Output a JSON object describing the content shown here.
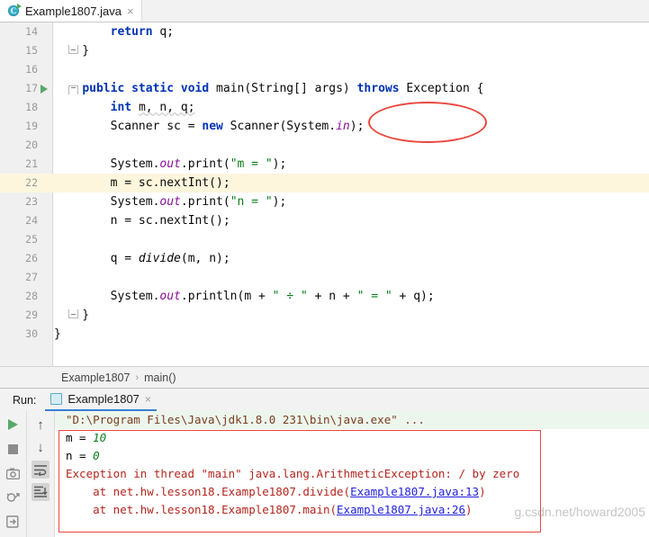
{
  "tab": {
    "label": "Example1807.java",
    "icon": "java-class-icon",
    "close": "×"
  },
  "editor": {
    "current_line": 22,
    "lines": [
      {
        "num": "14",
        "indent": 0,
        "text": "return q;",
        "marker": "",
        "fold": ""
      },
      {
        "num": "15",
        "indent": 0,
        "text": "}",
        "marker": "",
        "fold": "end"
      },
      {
        "num": "16",
        "indent": 0,
        "text": "",
        "marker": "",
        "fold": ""
      },
      {
        "num": "17",
        "indent": 0,
        "text": "public static void main(String[] args) throws Exception {",
        "marker": "run",
        "fold": "start"
      },
      {
        "num": "18",
        "indent": 0,
        "text": "int m, n, q;",
        "marker": "",
        "fold": ""
      },
      {
        "num": "19",
        "indent": 0,
        "text": "Scanner sc = new Scanner(System.in);",
        "marker": "",
        "fold": ""
      },
      {
        "num": "20",
        "indent": 0,
        "text": "",
        "marker": "",
        "fold": ""
      },
      {
        "num": "21",
        "indent": 0,
        "text": "System.out.print(\"m = \");",
        "marker": "",
        "fold": ""
      },
      {
        "num": "22",
        "indent": 0,
        "text": "m = sc.nextInt();",
        "marker": "",
        "fold": ""
      },
      {
        "num": "23",
        "indent": 0,
        "text": "System.out.print(\"n = \");",
        "marker": "",
        "fold": ""
      },
      {
        "num": "24",
        "indent": 0,
        "text": "n = sc.nextInt();",
        "marker": "",
        "fold": ""
      },
      {
        "num": "25",
        "indent": 0,
        "text": "",
        "marker": "",
        "fold": ""
      },
      {
        "num": "26",
        "indent": 0,
        "text": "q = divide(m, n);",
        "marker": "",
        "fold": ""
      },
      {
        "num": "27",
        "indent": 0,
        "text": "",
        "marker": "",
        "fold": ""
      },
      {
        "num": "28",
        "indent": 0,
        "text": "System.out.println(m + \" ÷ \" + n + \" = \" + q);",
        "marker": "",
        "fold": ""
      },
      {
        "num": "29",
        "indent": 0,
        "text": "}",
        "marker": "",
        "fold": "end"
      },
      {
        "num": "30",
        "indent": 0,
        "text": "}",
        "marker": "",
        "fold": ""
      }
    ],
    "annotation": {
      "shape": "ellipse",
      "targets": "throws Exception",
      "color": "#e8483f"
    }
  },
  "breadcrumb": {
    "class": "Example1807",
    "separator": "›",
    "method": "main()"
  },
  "run_window": {
    "label": "Run:",
    "tab_label": "Example1807",
    "tab_close": "×",
    "toolbar": [
      {
        "name": "rerun-button",
        "glyph": "run"
      },
      {
        "name": "stop-button",
        "glyph": "stop"
      },
      {
        "name": "screenshot-button",
        "glyph": "camera"
      },
      {
        "name": "rerun-failed-button",
        "glyph": "bug"
      },
      {
        "name": "export-button",
        "glyph": "export"
      }
    ],
    "toolbar2": [
      {
        "name": "scroll-up-button",
        "glyph": "↑",
        "pressed": false
      },
      {
        "name": "scroll-down-button",
        "glyph": "↓",
        "pressed": false
      },
      {
        "name": "soft-wrap-button",
        "glyph": "wrap",
        "pressed": true
      },
      {
        "name": "scroll-to-end-button",
        "glyph": "scrollend",
        "pressed": true
      }
    ],
    "console": {
      "command": "\"D:\\Program Files\\Java\\jdk1.8.0 231\\bin\\java.exe\" ...",
      "output": [
        {
          "type": "io",
          "prefix": "m = ",
          "value": "10"
        },
        {
          "type": "io",
          "prefix": "n = ",
          "value": "0"
        },
        {
          "type": "error",
          "text": "Exception in thread \"main\" java.lang.ArithmeticException: / by zero"
        },
        {
          "type": "trace",
          "prefix": "    at net.hw.lesson18.Example1807.divide(",
          "link": "Example1807.java:13",
          "suffix": ")"
        },
        {
          "type": "trace",
          "prefix": "    at net.hw.lesson18.Example1807.main(",
          "link": "Example1807.java:26",
          "suffix": ")"
        }
      ],
      "annotation": {
        "shape": "rectangle",
        "color": "#e8483f"
      }
    }
  },
  "watermark": "g.csdn.net/howard2005",
  "colors": {
    "keyword": "#0033b3",
    "string": "#067d17",
    "field": "#871094",
    "error": "#b3261e",
    "link": "#2222dd",
    "annotation": "#e8483f",
    "current_line": "#fdf6dd",
    "run_green": "#59a869"
  }
}
